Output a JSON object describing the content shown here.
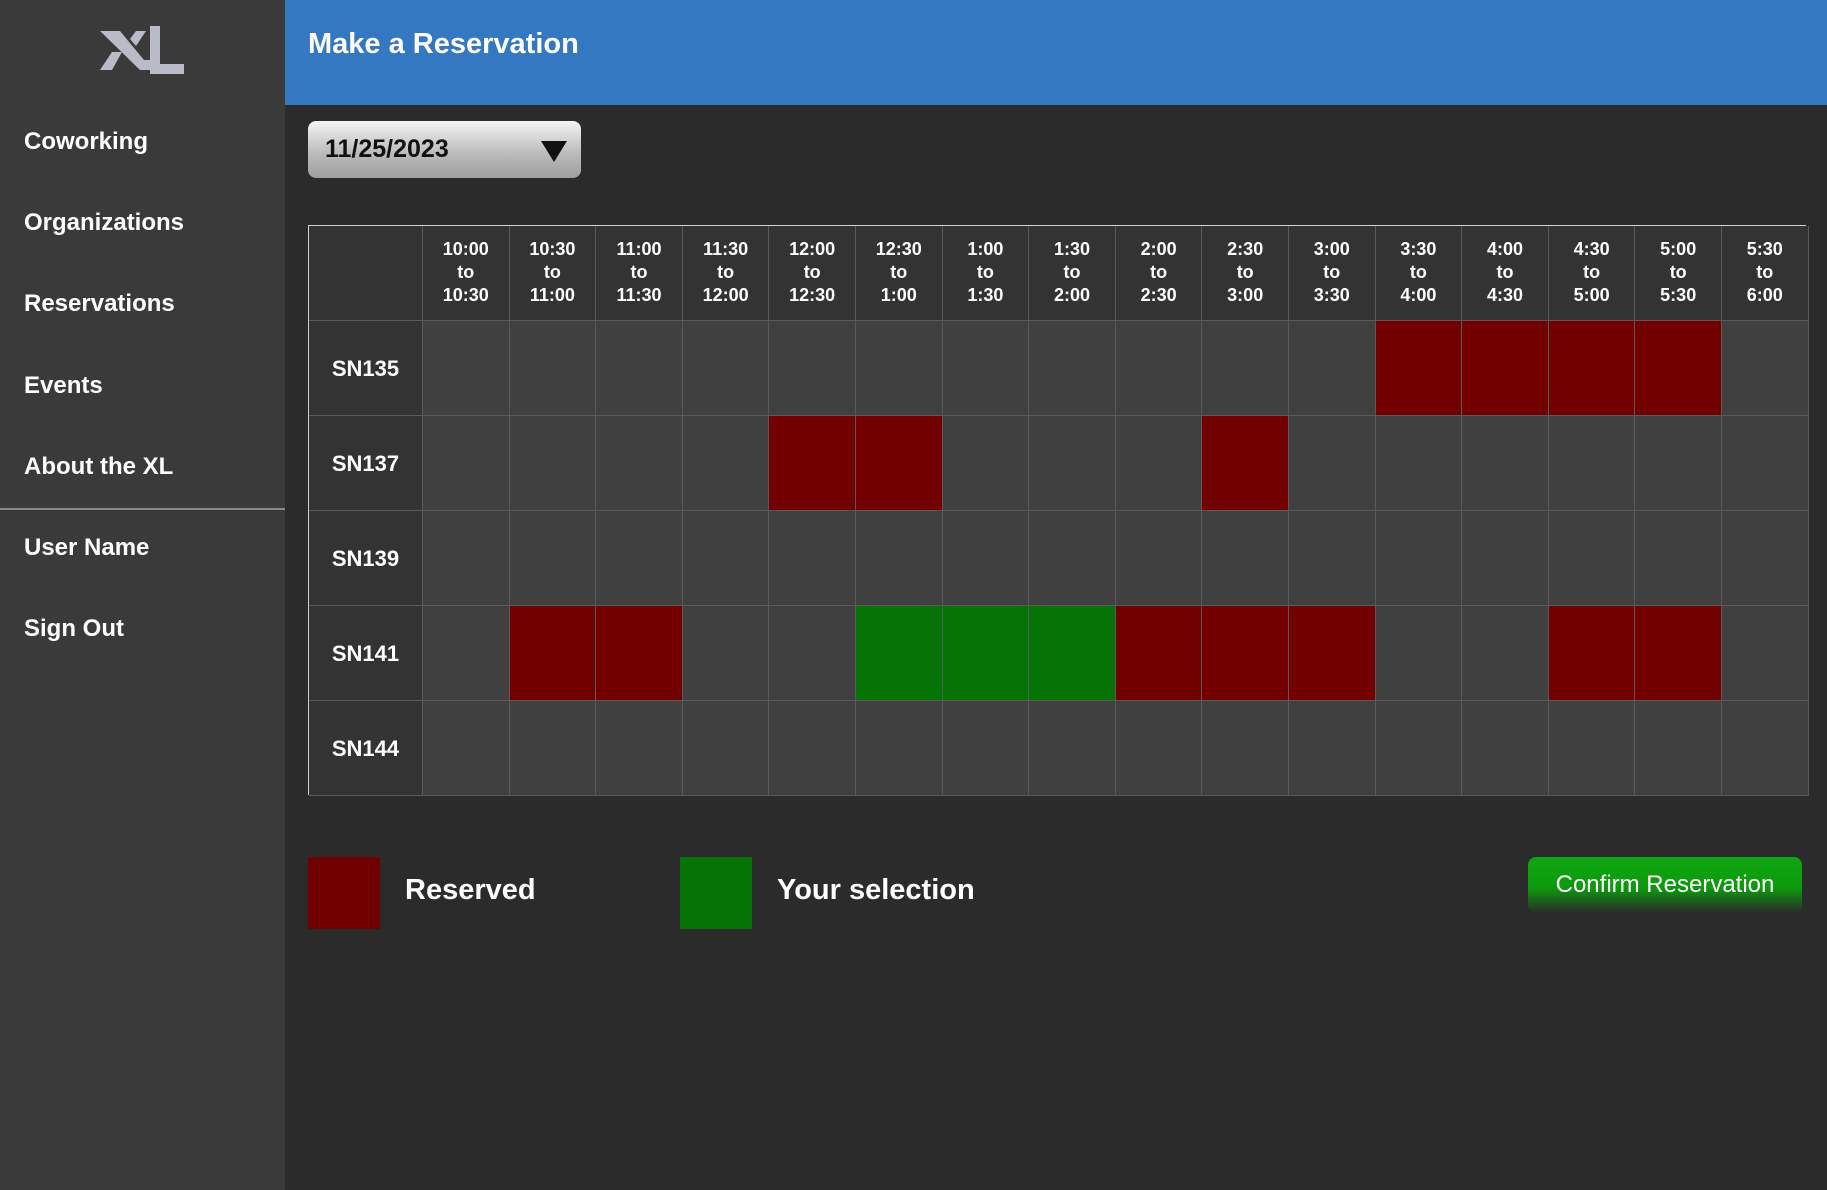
{
  "app": {
    "logo_text": "XL"
  },
  "sidebar": {
    "items": [
      {
        "label": "Coworking"
      },
      {
        "label": "Organizations"
      },
      {
        "label": "Reservations"
      },
      {
        "label": "Events"
      },
      {
        "label": "About the XL"
      }
    ],
    "account_items": [
      {
        "label": "User Name"
      },
      {
        "label": "Sign Out"
      }
    ]
  },
  "header": {
    "title": "Make a Reservation"
  },
  "date_picker": {
    "selected": "11/25/2023"
  },
  "schedule": {
    "time_slots": [
      [
        "10:00",
        "to",
        "10:30"
      ],
      [
        "10:30",
        "to",
        "11:00"
      ],
      [
        "11:00",
        "to",
        "11:30"
      ],
      [
        "11:30",
        "to",
        "12:00"
      ],
      [
        "12:00",
        "to",
        "12:30"
      ],
      [
        "12:30",
        "to",
        "1:00"
      ],
      [
        "1:00",
        "to",
        "1:30"
      ],
      [
        "1:30",
        "to",
        "2:00"
      ],
      [
        "2:00",
        "to",
        "2:30"
      ],
      [
        "2:30",
        "to",
        "3:00"
      ],
      [
        "3:00",
        "to",
        "3:30"
      ],
      [
        "3:30",
        "to",
        "4:00"
      ],
      [
        "4:00",
        "to",
        "4:30"
      ],
      [
        "4:30",
        "to",
        "5:00"
      ],
      [
        "5:00",
        "to",
        "5:30"
      ],
      [
        "5:30",
        "to",
        "6:00"
      ]
    ],
    "rooms": [
      {
        "name": "SN135",
        "slots": [
          "free",
          "free",
          "free",
          "free",
          "free",
          "free",
          "free",
          "free",
          "free",
          "free",
          "free",
          "reserved",
          "reserved",
          "reserved",
          "reserved",
          "free"
        ]
      },
      {
        "name": "SN137",
        "slots": [
          "free",
          "free",
          "free",
          "free",
          "reserved",
          "reserved",
          "free",
          "free",
          "free",
          "reserved",
          "free",
          "free",
          "free",
          "free",
          "free",
          "free"
        ]
      },
      {
        "name": "SN139",
        "slots": [
          "free",
          "free",
          "free",
          "free",
          "free",
          "free",
          "free",
          "free",
          "free",
          "free",
          "free",
          "free",
          "free",
          "free",
          "free",
          "free"
        ]
      },
      {
        "name": "SN141",
        "slots": [
          "free",
          "reserved",
          "reserved",
          "free",
          "free",
          "selected",
          "selected",
          "selected",
          "reserved",
          "reserved",
          "reserved",
          "free",
          "free",
          "reserved",
          "reserved",
          "free"
        ]
      },
      {
        "name": "SN144",
        "slots": [
          "free",
          "free",
          "free",
          "free",
          "free",
          "free",
          "free",
          "free",
          "free",
          "free",
          "free",
          "free",
          "free",
          "free",
          "free",
          "free"
        ]
      }
    ]
  },
  "legend": {
    "reserved_label": "Reserved",
    "selection_label": "Your selection"
  },
  "colors": {
    "reserved": "#730000",
    "selected": "#067306",
    "header": "#3478c1"
  },
  "actions": {
    "confirm_label": "Confirm Reservation"
  }
}
